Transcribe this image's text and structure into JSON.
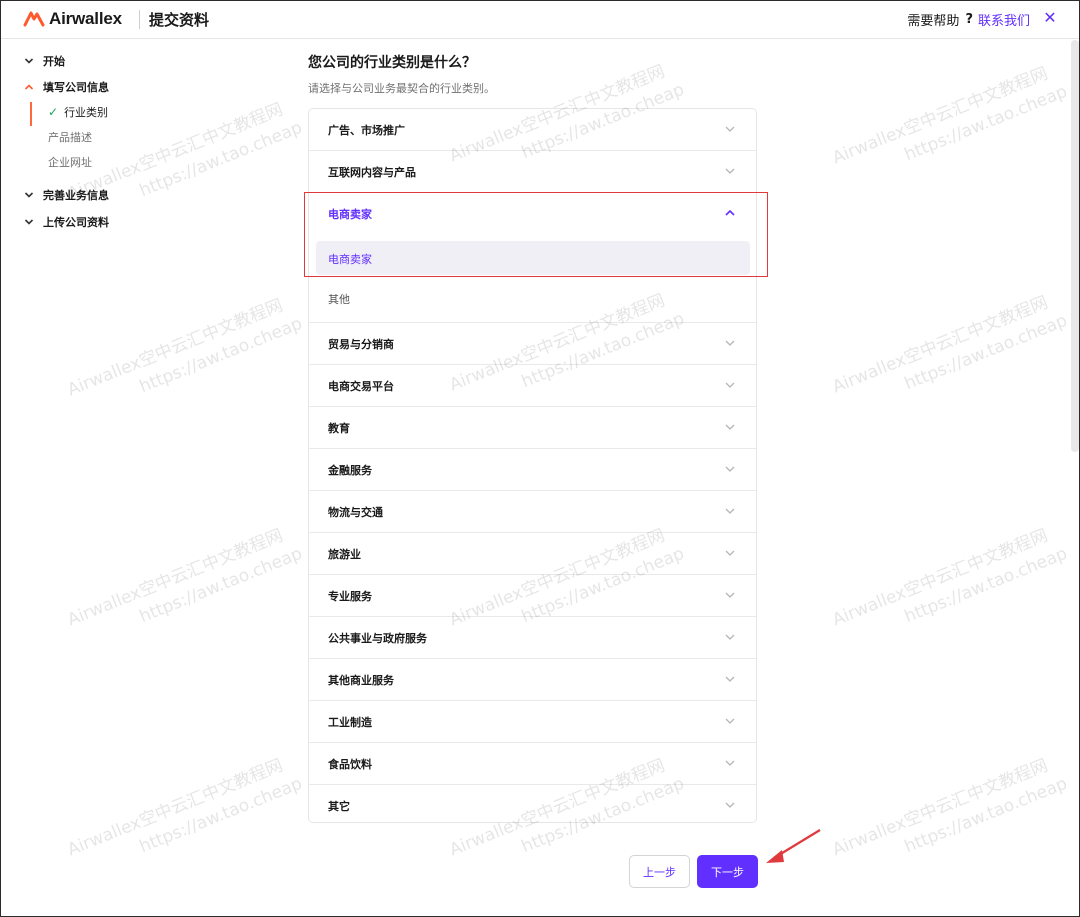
{
  "header": {
    "brand": "Airwallex",
    "title": "提交资料",
    "help_label": "需要帮助",
    "help_q": "?",
    "contact_link": "联系我们",
    "close_glyph": "✕"
  },
  "sidebar": {
    "sections": [
      {
        "label": "开始",
        "state": "collapsed"
      },
      {
        "label": "填写公司信息",
        "state": "expanded"
      },
      {
        "label": "完善业务信息",
        "state": "collapsed"
      },
      {
        "label": "上传公司资料",
        "state": "collapsed"
      }
    ],
    "sub_items": [
      {
        "label": "行业类别",
        "done": true,
        "active": true
      },
      {
        "label": "产品描述",
        "done": false,
        "active": false
      },
      {
        "label": "企业网址",
        "done": false,
        "active": false
      }
    ]
  },
  "main": {
    "question": "您公司的行业类别是什么？",
    "hint": "请选择与公司业务最契合的行业类别。",
    "categories": [
      {
        "label": "广告、市场推广"
      },
      {
        "label": "互联网内容与产品"
      },
      {
        "label": "电商卖家",
        "expanded": true,
        "options": [
          {
            "label": "电商卖家",
            "selected": true
          },
          {
            "label": "其他",
            "selected": false
          }
        ]
      },
      {
        "label": "贸易与分销商"
      },
      {
        "label": "电商交易平台"
      },
      {
        "label": "教育"
      },
      {
        "label": "金融服务"
      },
      {
        "label": "物流与交通"
      },
      {
        "label": "旅游业"
      },
      {
        "label": "专业服务"
      },
      {
        "label": "公共事业与政府服务"
      },
      {
        "label": "其他商业服务"
      },
      {
        "label": "工业制造"
      },
      {
        "label": "食品饮料"
      },
      {
        "label": "其它"
      }
    ]
  },
  "buttons": {
    "prev": "上一步",
    "next": "下一步"
  },
  "watermark": {
    "line1": "Airwallex空中云汇中文教程网",
    "line2": "https://aw.tao.cheap"
  },
  "colors": {
    "accent": "#612fff",
    "brand_orange": "#ff5a2d",
    "highlight_red": "#e0393e",
    "check_green": "#1f9f5c"
  }
}
